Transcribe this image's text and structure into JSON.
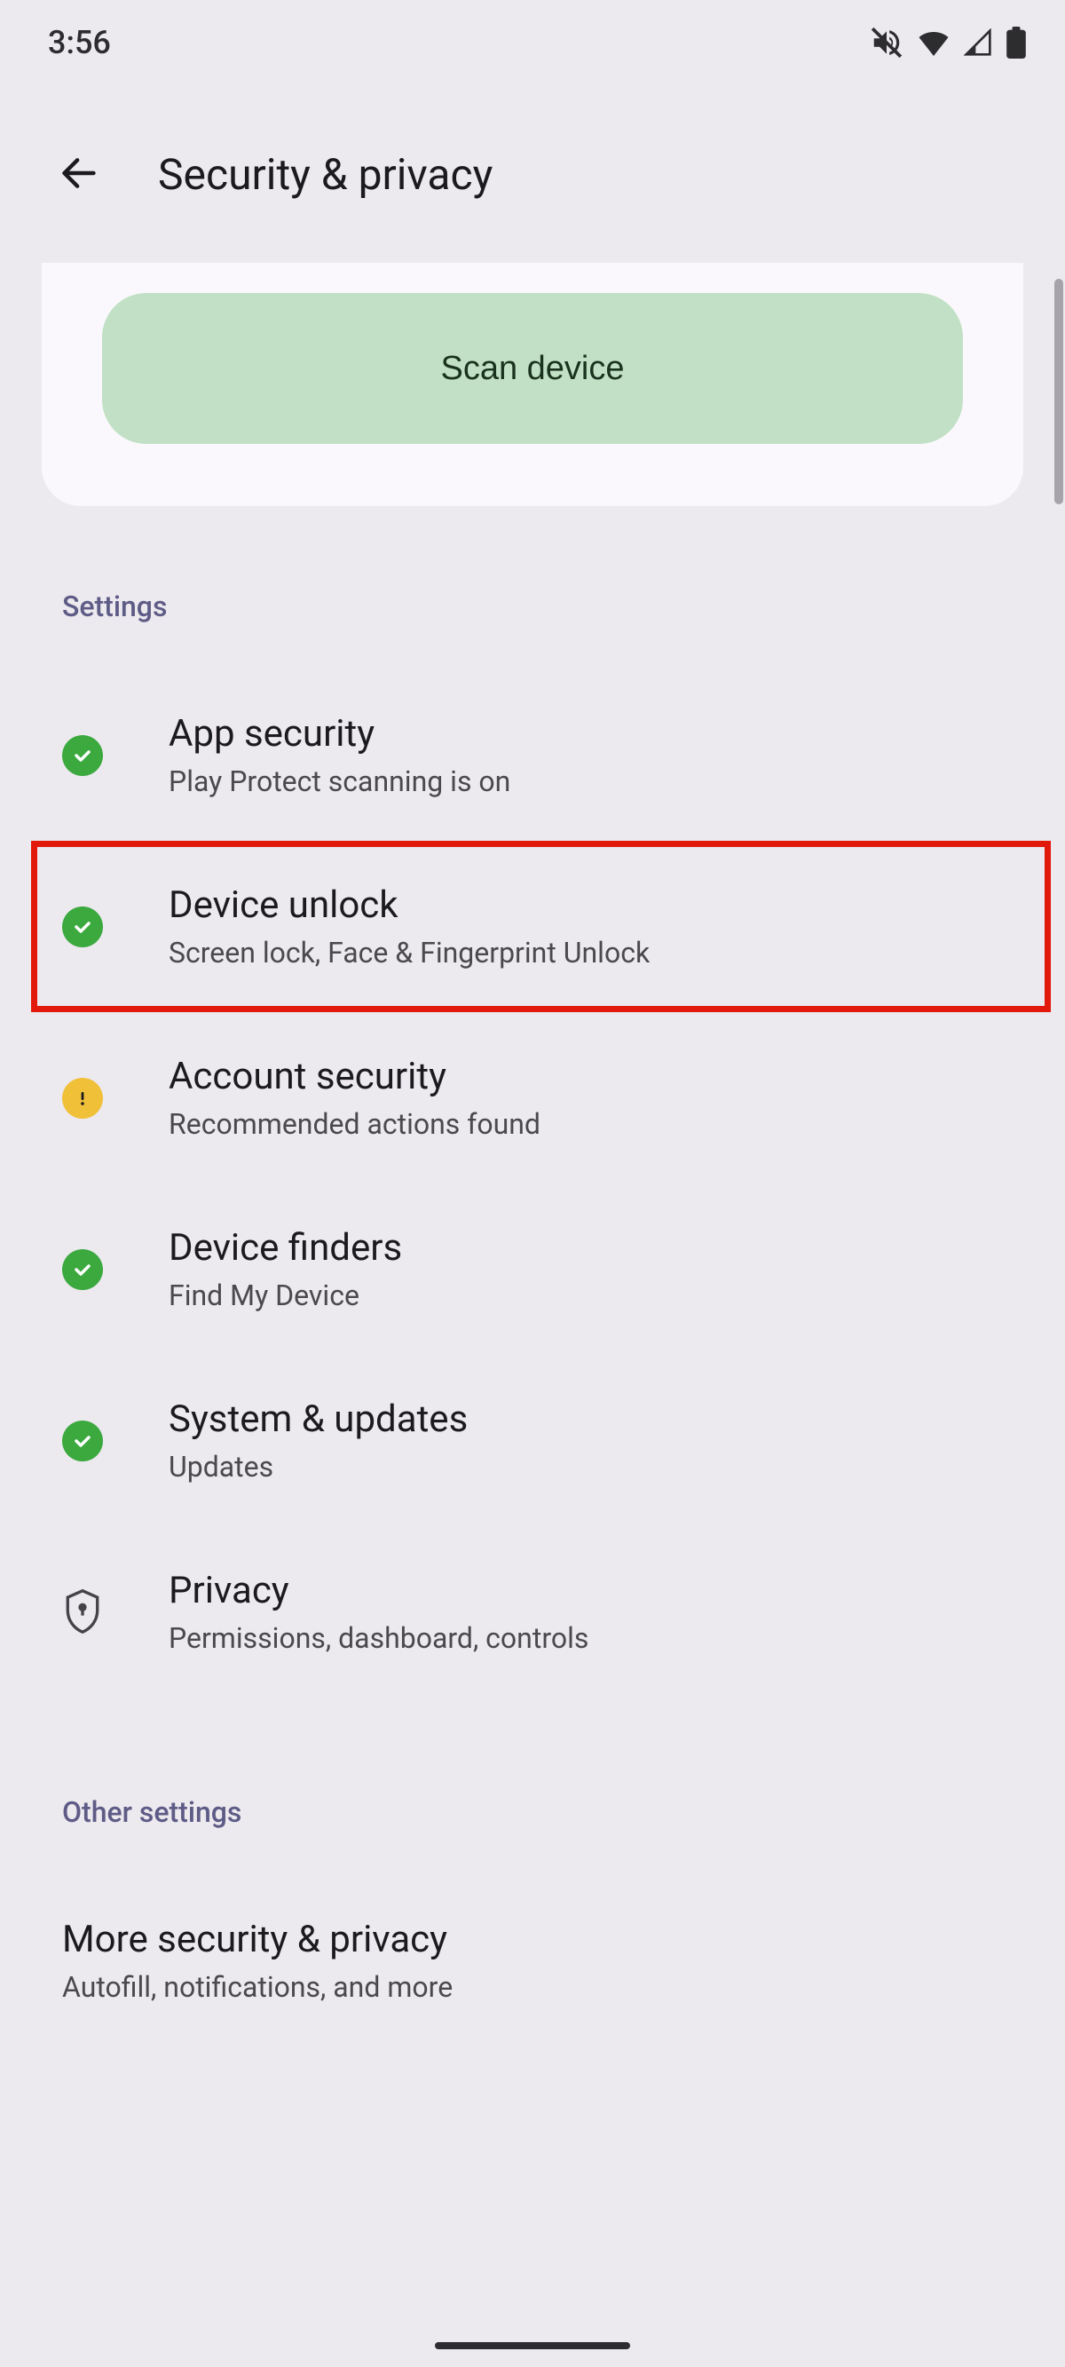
{
  "status": {
    "time": "3:56"
  },
  "header": {
    "title": "Security & privacy"
  },
  "scan": {
    "button_label": "Scan device"
  },
  "sections": {
    "settings_label": "Settings",
    "other_label": "Other settings"
  },
  "items": {
    "app_security": {
      "title": "App security",
      "subtitle": "Play Protect scanning is on"
    },
    "device_unlock": {
      "title": "Device unlock",
      "subtitle": "Screen lock, Face & Fingerprint Unlock"
    },
    "account_security": {
      "title": "Account security",
      "subtitle": "Recommended actions found"
    },
    "device_finders": {
      "title": "Device finders",
      "subtitle": "Find My Device"
    },
    "system_updates": {
      "title": "System & updates",
      "subtitle": "Updates"
    },
    "privacy": {
      "title": "Privacy",
      "subtitle": "Permissions, dashboard, controls"
    },
    "more": {
      "title": "More security & privacy",
      "subtitle": "Autofill, notifications, and more"
    }
  }
}
